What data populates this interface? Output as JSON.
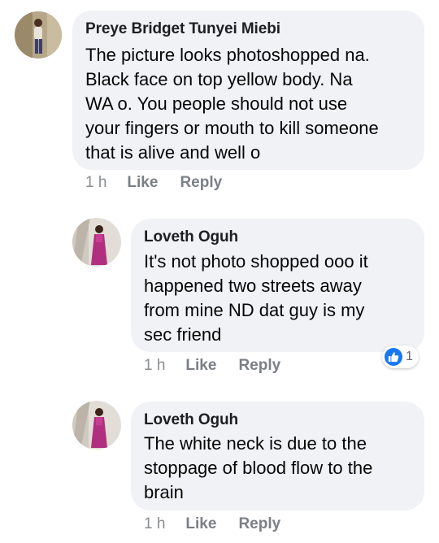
{
  "comments": [
    {
      "author": "Preye Bridget Tunyei Miebi",
      "text_lines": [
        "The picture looks photoshopped na.",
        "Black face on top yellow body. Na",
        "WA o.  You people should not use",
        "your fingers or mouth to kill someone",
        "that is alive and well o"
      ],
      "time": "1 h",
      "like_label": "Like",
      "reply_label": "Reply"
    },
    {
      "author": "Loveth Oguh",
      "text_lines": [
        "It's not photo shopped ooo it",
        "happened two streets away",
        "from mine ND dat guy is my",
        "sec friend"
      ],
      "time": "1 h",
      "like_label": "Like",
      "reply_label": "Reply",
      "reaction_count": "1",
      "reaction_icon": "thumbs-up-icon",
      "reaction_color": "#1877f2"
    },
    {
      "author": "Loveth Oguh",
      "text_lines": [
        "The white neck is due to the",
        "stoppage of blood flow to the",
        "brain"
      ],
      "time": "1 h",
      "like_label": "Like",
      "reply_label": "Reply"
    }
  ]
}
